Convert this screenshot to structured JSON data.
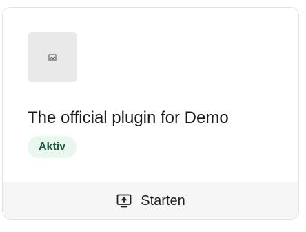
{
  "plugin": {
    "title": "The official plugin for Demo",
    "status_badge": "Aktiv",
    "thumbnail_icon": "image-icon"
  },
  "action": {
    "label": "Starten",
    "icon": "monitor-upload-icon"
  },
  "colors": {
    "badge_bg": "#e9f7ef",
    "badge_text": "#1f5a3a",
    "border": "#e3e3e3",
    "footer_bg": "#f6f6f6"
  }
}
